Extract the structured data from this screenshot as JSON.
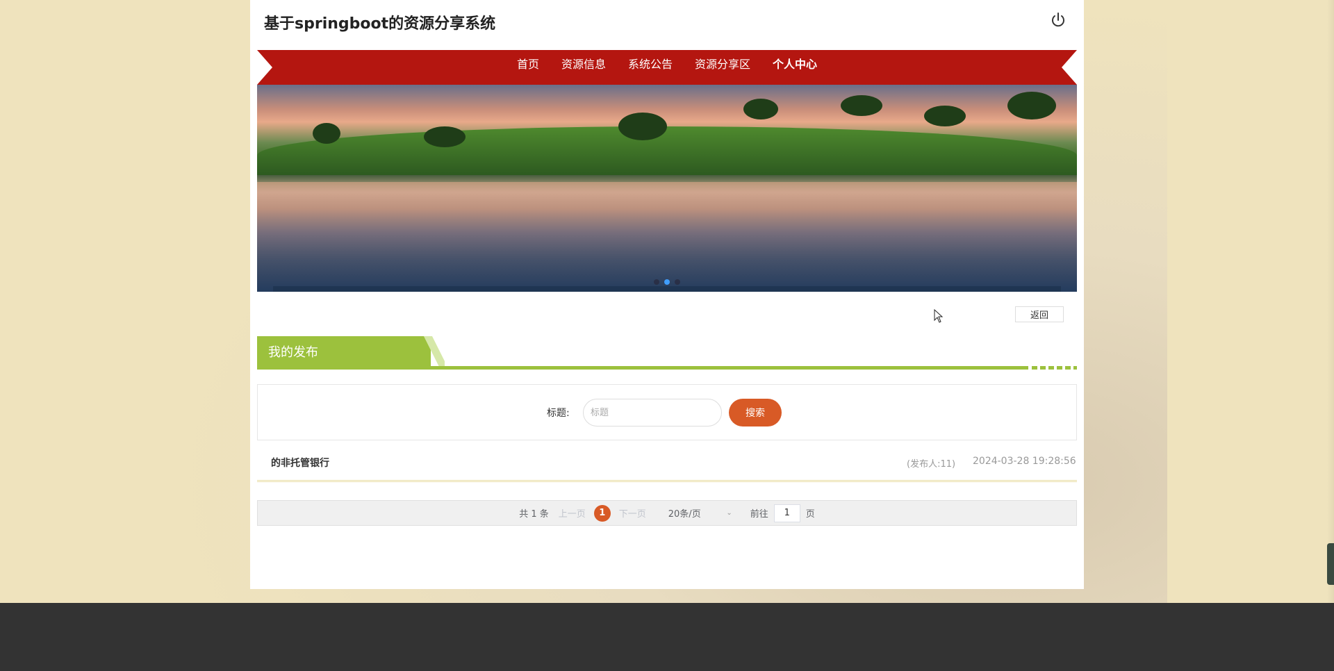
{
  "header": {
    "site_title": "基于springboot的资源分享系统",
    "logout_icon": "power-icon"
  },
  "nav": {
    "items": [
      {
        "label": "首页"
      },
      {
        "label": "资源信息"
      },
      {
        "label": "系统公告"
      },
      {
        "label": "资源分享区"
      },
      {
        "label": "个人中心"
      }
    ],
    "active": "个人中心",
    "bg_color": "#b41610"
  },
  "banner": {
    "dots": 3,
    "active_dot": 2,
    "description": "lakeside landscape with trees reflected in water at sunset"
  },
  "actions": {
    "back_label": "返回"
  },
  "section": {
    "title": "我的发布",
    "accent_color": "#9cc13d"
  },
  "search": {
    "label": "标题:",
    "placeholder": "标题",
    "value": "",
    "button_label": "搜索",
    "button_color": "#d85a26"
  },
  "list": {
    "items": [
      {
        "title": "的非托管银行",
        "author": "(发布人:11)",
        "time": "2024-03-28 19:28:56"
      }
    ]
  },
  "pagination": {
    "total": "共 1 条",
    "prev": "上一页",
    "current_page": "1",
    "next": "下一页",
    "page_size": "20条/页",
    "goto_label": "前往",
    "goto_value": "1",
    "page_suffix": "页"
  }
}
